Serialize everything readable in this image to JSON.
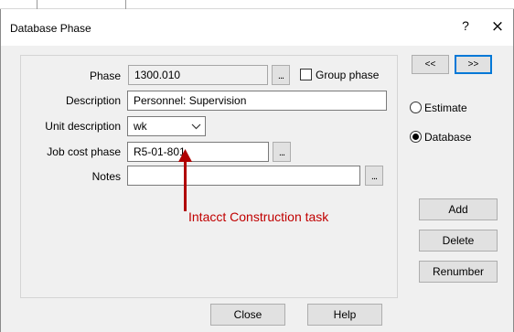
{
  "window": {
    "title": "Database Phase",
    "help_glyph": "?",
    "close_glyph": "×"
  },
  "form": {
    "phase": {
      "label": "Phase",
      "value": "1300.010"
    },
    "group_phase": {
      "label": "Group phase",
      "checked": false
    },
    "description": {
      "label": "Description",
      "value": "Personnel: Supervision"
    },
    "unit_description": {
      "label": "Unit description",
      "value": "wk"
    },
    "job_cost_phase": {
      "label": "Job cost phase",
      "value": "R5-01-801"
    },
    "notes": {
      "label": "Notes",
      "value": ""
    },
    "browse_label": "..."
  },
  "nav": {
    "prev_label": "<<",
    "next_label": ">>"
  },
  "mode": {
    "options": [
      {
        "label": "Estimate",
        "selected": false
      },
      {
        "label": "Database",
        "selected": true
      }
    ]
  },
  "actions": {
    "add": "Add",
    "delete": "Delete",
    "renumber": "Renumber"
  },
  "footer": {
    "close": "Close",
    "help": "Help"
  },
  "annotation": {
    "text": "Intacct Construction task",
    "color": "#c00000"
  },
  "colors": {
    "focus_accent": "#0078d7",
    "annotation_arrow": "#b00000"
  }
}
